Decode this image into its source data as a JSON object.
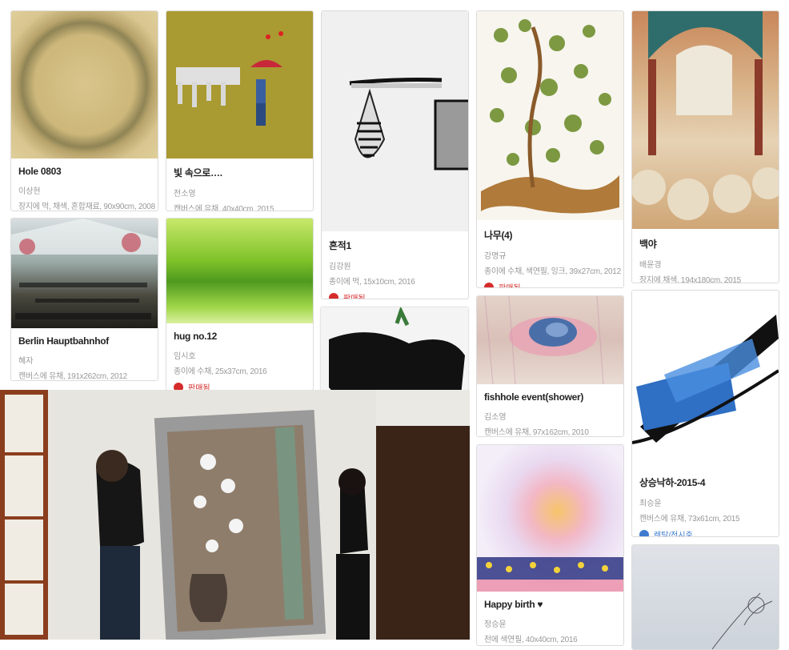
{
  "cards": [
    {
      "id": "c1",
      "title": "Hole 0803",
      "artist": "이상현",
      "meta": "장지에 먹, 채색, 혼합재료, 90x90cm, 2008",
      "status": ""
    },
    {
      "id": "c2",
      "title": "빛 속으로….",
      "artist": "전소영",
      "meta": "캔버스에 유채, 40x40cm, 2015",
      "status": ""
    },
    {
      "id": "c3",
      "title": "흔적1",
      "artist": "김강원",
      "meta": "종이에 먹, 15x10cm, 2016",
      "status": "판매됨"
    },
    {
      "id": "c4",
      "title": "나무(4)",
      "artist": "강명규",
      "meta": "종이에 수채, 색연필, 잉크, 39x27cm, 2012",
      "status": "판매됨"
    },
    {
      "id": "c5",
      "title": "백야",
      "artist": "배윤경",
      "meta": "장지에 채색, 194x180cm, 2015",
      "status": ""
    },
    {
      "id": "c6",
      "title": "Berlin Hauptbahnhof",
      "artist": "혜자",
      "meta": "캔버스에 유채, 191x262cm, 2012",
      "status": ""
    },
    {
      "id": "c7",
      "title": "hug no.12",
      "artist": "임시호",
      "meta": "종이에 수채, 25x37cm, 2016",
      "status": "판매됨"
    },
    {
      "id": "c8",
      "title": "fishhole event(shower)",
      "artist": "김소영",
      "meta": "캔버스에 유채, 97x162cm, 2010",
      "status": ""
    },
    {
      "id": "c9",
      "title": "상승낙하-2015-4",
      "artist": "최승윤",
      "meta": "캔버스에 유채, 73x61cm, 2015",
      "status": "렌탈/전시중"
    },
    {
      "id": "c10",
      "title": "Happy birth ♥",
      "artist": "정승윤",
      "meta": "천에 색연필, 40x40cm, 2016",
      "status": ""
    }
  ],
  "colors": {
    "sold": "#d62b2b",
    "rental": "#3e7bd0"
  }
}
